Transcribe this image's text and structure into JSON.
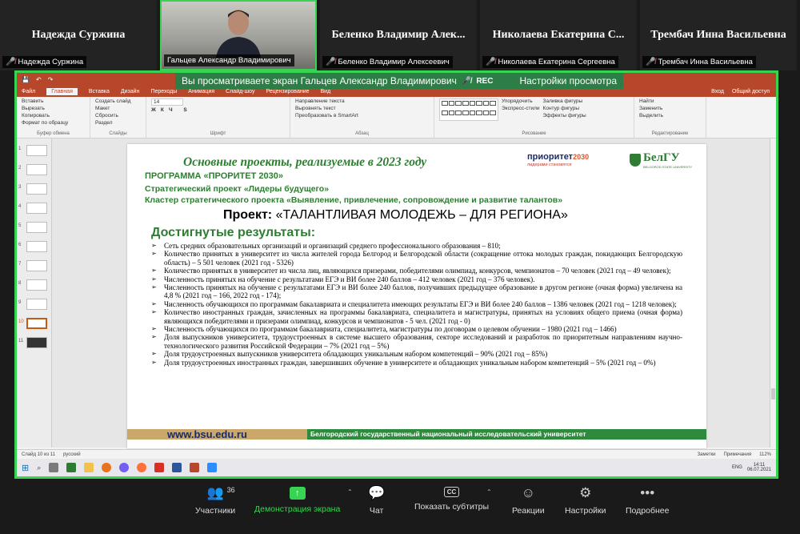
{
  "gallery": [
    {
      "big": "Надежда Суржина",
      "label": "Надежда Суржина",
      "muted": true,
      "video": false
    },
    {
      "big": "",
      "label": "Гальцев Александр Владимирович",
      "muted": false,
      "video": true
    },
    {
      "big": "Беленко Владимир Алек...",
      "label": "Беленко Владимир Алексеевич",
      "muted": true,
      "video": false
    },
    {
      "big": "Николаева Екатерина С...",
      "label": "Николаева Екатерина Сергеевна",
      "muted": true,
      "video": false
    },
    {
      "big": "Трембач Инна Васильевна",
      "label": "Трембач Инна Васильевна",
      "muted": true,
      "video": false
    }
  ],
  "banner": {
    "text": "Вы просматриваете экран Гальцев Александр Владимирович",
    "rec": "REC",
    "settings": "Настройки просмотра"
  },
  "ppt": {
    "tabs": [
      "Файл",
      "Главная",
      "Вставка",
      "Дизайн",
      "Переходы",
      "Анимация",
      "Слайд-шоу",
      "Рецензирование",
      "Вид"
    ],
    "tabs_right": [
      "Вход",
      "Общий доступ"
    ],
    "groups": [
      {
        "name": "Буфер обмена",
        "items": [
          "Вставить",
          "Вырезать",
          "Копировать",
          "Формат по образцу"
        ]
      },
      {
        "name": "Слайды",
        "items": [
          "Создать слайд",
          "Макет",
          "Сбросить",
          "Раздел"
        ]
      },
      {
        "name": "Шрифт",
        "items": [
          "14"
        ]
      },
      {
        "name": "Абзац",
        "items": [
          "Направление текста",
          "Выровнять текст",
          "Преобразовать в SmartArt"
        ]
      },
      {
        "name": "Рисование",
        "items": [
          "Упорядочить",
          "Экспресс-стили",
          "Заливка фигуры",
          "Контур фигуры",
          "Эффекты фигуры"
        ]
      },
      {
        "name": "Редактирование",
        "items": [
          "Найти",
          "Заменить",
          "Выделить"
        ]
      }
    ],
    "status_left": [
      "Слайд 10 из 11",
      "русский"
    ],
    "status_right": [
      "Заметки",
      "Примечания",
      "112%"
    ],
    "clock": {
      "time": "14:11",
      "date": "06.07.2021",
      "lang": "ENG"
    }
  },
  "slide": {
    "title": "Основные проекты, реализуемые в 2023 году",
    "program": "ПРОГРАММА «ПРОРИТЕТ 2030»",
    "sub1": "Стратегический проект «Лидеры будущего»",
    "sub2": "Кластер стратегического проекта «Выявление, привлечение, сопровождение и развитие талантов»",
    "project_prefix": "Проект: ",
    "project_name": "«ТАЛАНТЛИВАЯ МОЛОДЕЖЬ – ДЛЯ РЕГИОНА»",
    "achieved": "Достигнутые результаты:",
    "logo_priority": "приоритет",
    "logo_priority_num": "2030",
    "logo_priority_tag": "лидерами становятся",
    "logo_bsu": "БелГУ",
    "logo_bsu_small": "BELGOROD STATE UNIVERSITY",
    "bullets": [
      "Сеть средних образовательных организаций и организаций среднего профессионального образования – 810;",
      "Количество принятых в университет из числа жителей города Белгород и Белгородской области (сокращение оттока молодых граждан, покидающих Белгородскую область) – 5 501 человек (2021 год - 5326)",
      "Количество принятых в университет из числа лиц, являющихся призерами, победителями олимпиад, конкурсов, чемпионатов – 70 человек (2021 год – 49 человек);",
      "Численность принятых на обучение с результатами ЕГЭ и ВИ более 240 баллов – 412 человек (2021 год – 376 человек).",
      "Численность принятых на обучение с результатами ЕГЭ и ВИ более 240 баллов, получивших предыдущее образование в другом регионе (очная форма) увеличена на 4,8 % (2021 год – 166, 2022 год - 174);",
      "Численность обучающихся по программам бакалавриата и специалитета имеющих результаты ЕГЭ и ВИ более 240 баллов – 1386 человек (2021 год – 1218 человек);",
      "Количество иностранных граждан, зачисленных на программы бакалавриата, специалитета и магистратуры, принятых на условиях общего приема (очная форма) являющихся победителями и призерами олимпиад, конкурсов и чемпионатов - 5 чел. (2021 год - 0)",
      "Численность обучающихся по программам бакалавриата, специалитета, магистратуры по договорам о целевом обучении – 1980 (2021 год – 1466)",
      "Доля выпускников университета, трудоустроенных в системе высшего образования, секторе исследований и разработок по приоритетным направлениям научно-технологического развития Российской Федерации – 7% (2021 год – 5%)",
      "Доля трудоустроенных выпускников университета обладающих уникальным набором компетенций – 90% (2021 год – 85%)",
      "Доля трудоустроенных иностранных граждан, завершивших обучение в университете и обладающих уникальным набором компетенций – 5% (2021 год – 0%)"
    ],
    "footer_site": "www.bsu.edu.ru",
    "footer_univ": "Белгородский государственный национальный исследовательский университет"
  },
  "slide_numbers": [
    "1",
    "2",
    "3",
    "4",
    "5",
    "6",
    "7",
    "8",
    "9",
    "10",
    "11"
  ],
  "controls": {
    "participants": "Участники",
    "participants_count": "36",
    "share": "Демонстрация экрана",
    "chat": "Чат",
    "subtitles": "Показать субтитры",
    "subtitles_icon": "CC",
    "reactions": "Реакции",
    "settings": "Настройки",
    "more": "Подробнее"
  },
  "colors": {
    "accent": "#39d353",
    "slide_green": "#2e7d32",
    "ppt_red": "#b7472a"
  }
}
